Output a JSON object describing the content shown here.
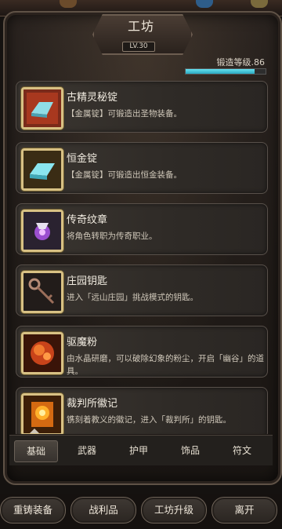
{
  "header": {
    "title": "工坊",
    "level": "LV.30",
    "forge_label": "锻造等级.86",
    "forge_progress_fraction": 0.86
  },
  "items": [
    {
      "title": "古精灵秘锭",
      "desc": "【金属锭】可锻造出圣物装备。",
      "icon": "ancient-elf-ingot-icon",
      "color": "#b7402a"
    },
    {
      "title": "恒金锭",
      "desc": "【金属锭】可锻造出恒金装备。",
      "icon": "eternal-gold-ingot-icon",
      "color": "#6fd2de"
    },
    {
      "title": "传奇纹章",
      "desc": "将角色转职为传奇职业。",
      "icon": "legend-emblem-icon",
      "color": "#a95fd6"
    },
    {
      "title": "庄园钥匙",
      "desc": "进入「远山庄园」挑战模式的钥匙。",
      "icon": "manor-key-icon",
      "color": "#9b6e5a"
    },
    {
      "title": "驱魔粉",
      "desc": "由水晶研磨，可以破除幻象的粉尘，开启「幽谷」的道具。",
      "icon": "exorcism-powder-icon",
      "color": "#e25b1e"
    },
    {
      "title": "裁判所徽记",
      "desc": "镌刻着教义的徽记，进入「裁判所」的钥匙。",
      "icon": "inquisition-emblem-icon",
      "color": "#f2a020"
    }
  ],
  "tabs": [
    "基础",
    "武器",
    "护甲",
    "饰品",
    "符文"
  ],
  "active_tab": "基础",
  "bottom_buttons": [
    "重铸装备",
    "战利品",
    "工坊升级",
    "离开"
  ]
}
